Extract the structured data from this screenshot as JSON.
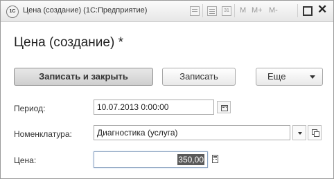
{
  "window": {
    "app_icon_text": "1С",
    "title": "Цена (создание)  (1С:Предприятие)",
    "toolbar": {
      "m_label": "M",
      "m_plus_label": "M+",
      "m_minus_label": "M-",
      "calendar_icon_text": "31"
    }
  },
  "form": {
    "title": "Цена (создание) *",
    "buttons": {
      "save_close": "Записать и закрыть",
      "save": "Записать",
      "more": "Еще"
    },
    "fields": {
      "period": {
        "label": "Период:",
        "value": "10.07.2013  0:00:00"
      },
      "nomenclature": {
        "label": "Номенклатура:",
        "value": "Диагностика (услуга)"
      },
      "price": {
        "label": "Цена:",
        "value": "350,00"
      }
    }
  }
}
